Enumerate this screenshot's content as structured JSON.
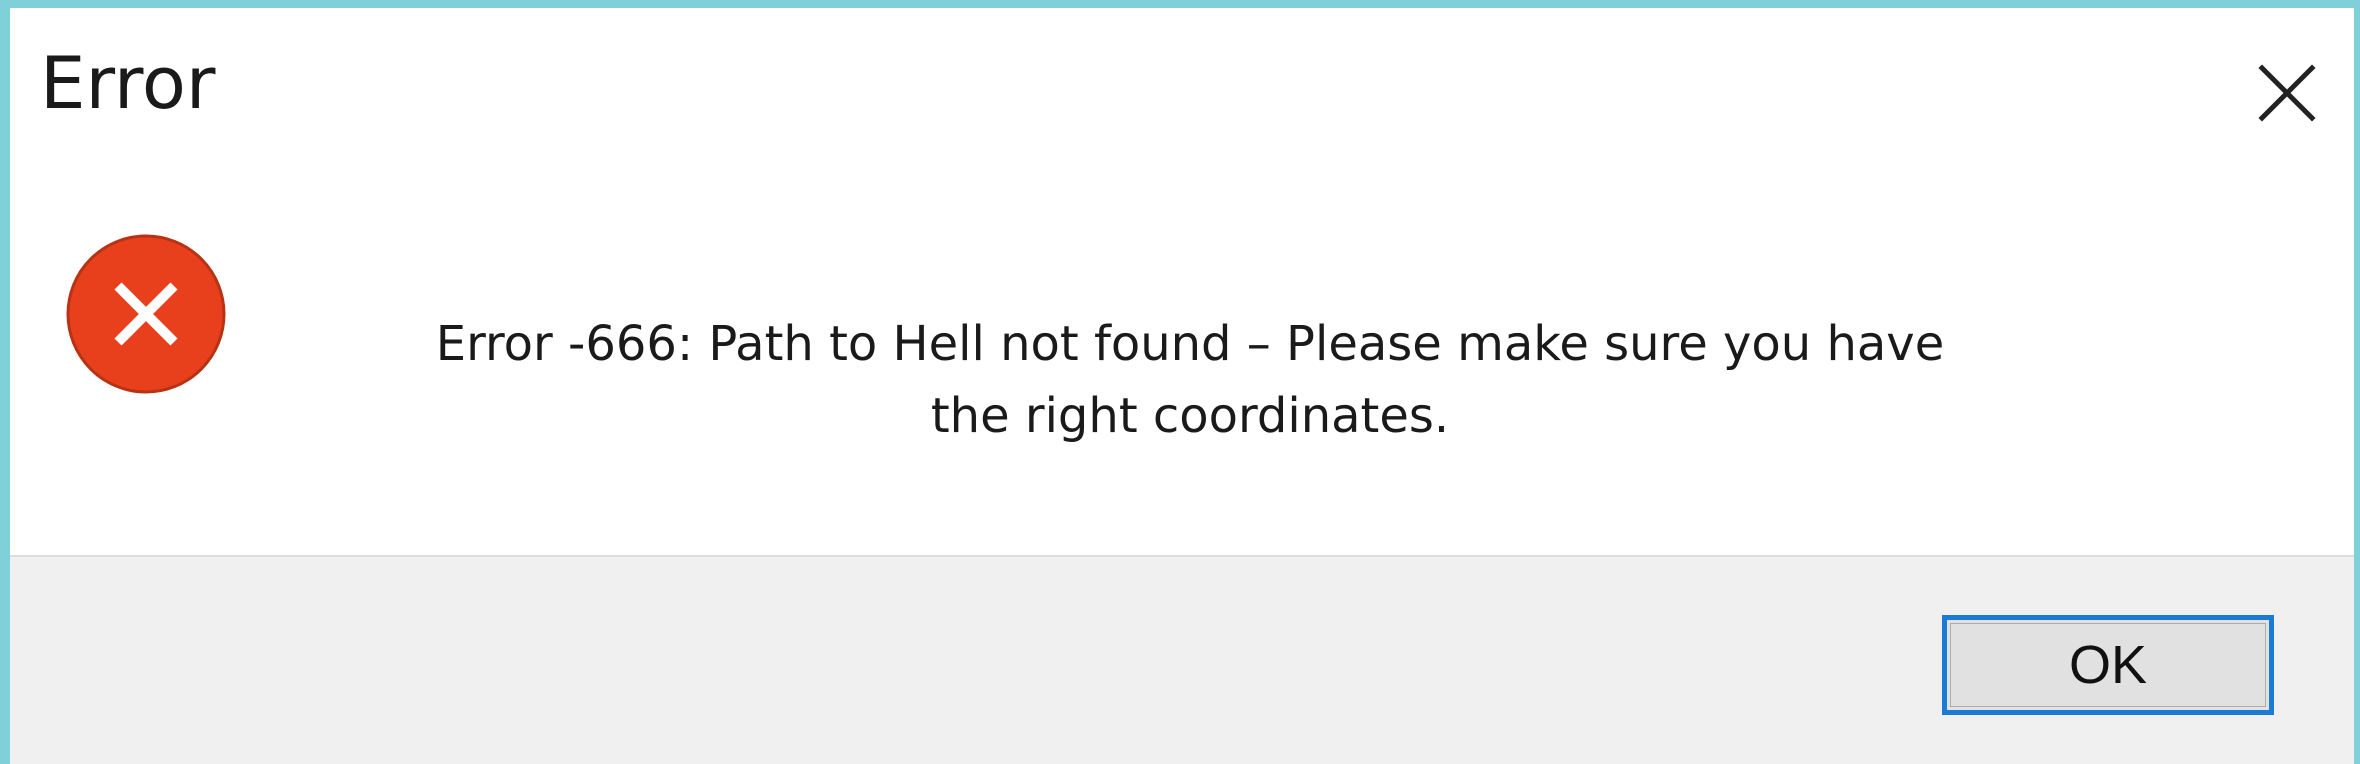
{
  "dialog": {
    "title": "Error",
    "close_icon": "close-icon",
    "icon": "error-icon",
    "message_line1": "Error -666: Path to Hell not found – Please make sure you have",
    "message_line2": "the right coordinates.",
    "ok_label": "OK"
  },
  "colors": {
    "window_border": "#7fd0d8",
    "error_icon_fill": "#e8401c",
    "footer_background": "#f0f0f0",
    "button_focus_border": "#1a7ad4",
    "button_background": "#e1e1e1"
  }
}
